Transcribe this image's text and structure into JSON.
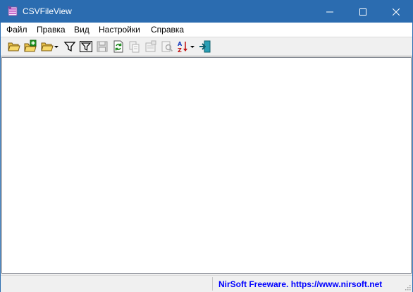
{
  "window": {
    "title": "CSVFileView",
    "title_bar_color": "#2b6cb0"
  },
  "menu": {
    "items": [
      "Файл",
      "Правка",
      "Вид",
      "Настройки",
      "Справка"
    ]
  },
  "toolbar": {
    "buttons": [
      {
        "icon": "open-folder-icon",
        "enabled": true
      },
      {
        "icon": "open-folder-green-icon",
        "enabled": true
      },
      {
        "icon": "open-folder-dropdown-icon",
        "enabled": true
      },
      {
        "icon": "filter-icon",
        "enabled": true
      },
      {
        "icon": "filter-advanced-icon",
        "enabled": true
      },
      {
        "icon": "save-icon",
        "enabled": false
      },
      {
        "icon": "refresh-icon",
        "enabled": true
      },
      {
        "icon": "copy-icon",
        "enabled": false
      },
      {
        "icon": "properties-icon",
        "enabled": false
      },
      {
        "icon": "find-icon",
        "enabled": false
      },
      {
        "icon": "sort-az-dropdown-icon",
        "enabled": true
      },
      {
        "icon": "exit-icon",
        "enabled": true
      }
    ]
  },
  "statusbar": {
    "link_text": "NirSoft Freeware. https://www.nirsoft.net",
    "link_color": "#0000ff"
  }
}
